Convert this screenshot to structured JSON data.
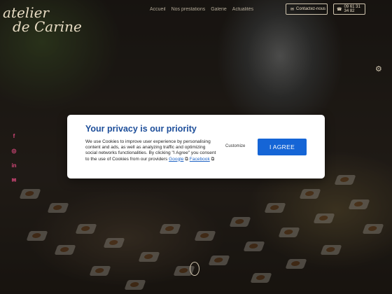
{
  "site": {
    "logo_line1": "atelier",
    "logo_line2": "de Carine"
  },
  "nav": {
    "items": [
      "Accueil",
      "Nos prestations",
      "Galerie",
      "Actualités"
    ]
  },
  "header": {
    "contact_label": "Contactez-nous",
    "phone_label": "09 61 31 34 82"
  },
  "cookie": {
    "title": "Your privacy is our priority",
    "body": "We use Cookies to improve user experience by personalising content and ads, as well as analyzing traffic and optimizing social networks functionalities. By clicking \"I Agree\" you consent to the use of Cookies from our providers",
    "link_google": "Google",
    "link_facebook": "Facebook",
    "customize_label": "Customize",
    "agree_label": "I AGREE"
  },
  "colors": {
    "modal_title": "#1d4e9a",
    "agree_button": "#1565d6",
    "social_icons": "#d6477a"
  }
}
